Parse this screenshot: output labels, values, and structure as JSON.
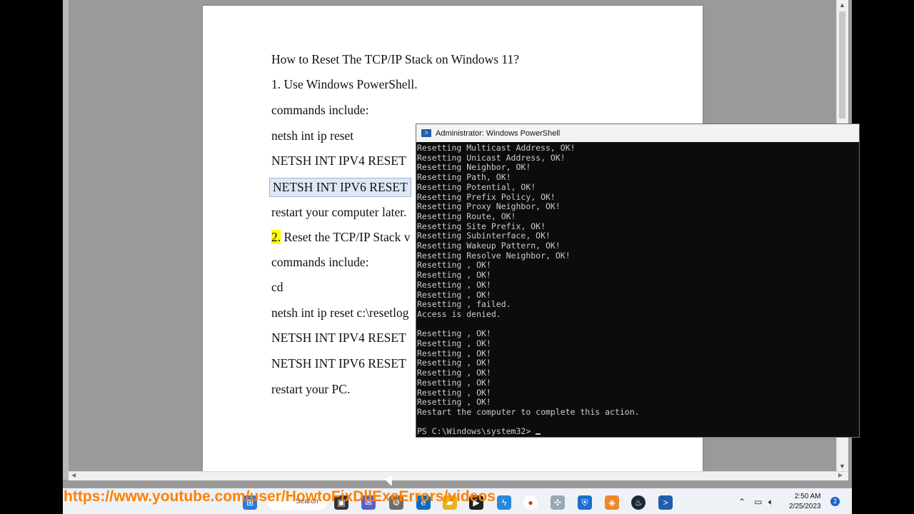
{
  "document": {
    "lines": [
      "How to Reset The TCP/IP Stack on Windows 11?",
      "1. Use Windows PowerShell.",
      "commands include:",
      "netsh int ip reset",
      "NETSH INT IPV4 RESET",
      "NETSH INT IPV6 RESET",
      " restart your computer later.",
      "2.",
      " Reset the TCP/IP Stack v",
      "commands include:",
      "cd",
      "netsh int ip reset c:\\resetlog",
      "NETSH INT IPV4 RESET",
      "NETSH INT IPV6 RESET",
      "restart your PC."
    ]
  },
  "powershell": {
    "title": "Administrator: Windows PowerShell",
    "output": "Resetting Multicast Address, OK!\nResetting Unicast Address, OK!\nResetting Neighbor, OK!\nResetting Path, OK!\nResetting Potential, OK!\nResetting Prefix Policy, OK!\nResetting Proxy Neighbor, OK!\nResetting Route, OK!\nResetting Site Prefix, OK!\nResetting Subinterface, OK!\nResetting Wakeup Pattern, OK!\nResetting Resolve Neighbor, OK!\nResetting , OK!\nResetting , OK!\nResetting , OK!\nResetting , OK!\nResetting , failed.\nAccess is denied.\n\nResetting , OK!\nResetting , OK!\nResetting , OK!\nResetting , OK!\nResetting , OK!\nResetting , OK!\nResetting , OK!\nResetting , OK!\nRestart the computer to complete this action.\n",
    "prompt": "PS C:\\Windows\\system32> "
  },
  "taskbar": {
    "search_label": "Search",
    "time": "2:50 AM",
    "date": "2/25/2023",
    "notification_count": "2"
  },
  "overlay": {
    "url": "https://www.youtube.com/user/HowtoFixDllExeErrors/videos"
  }
}
